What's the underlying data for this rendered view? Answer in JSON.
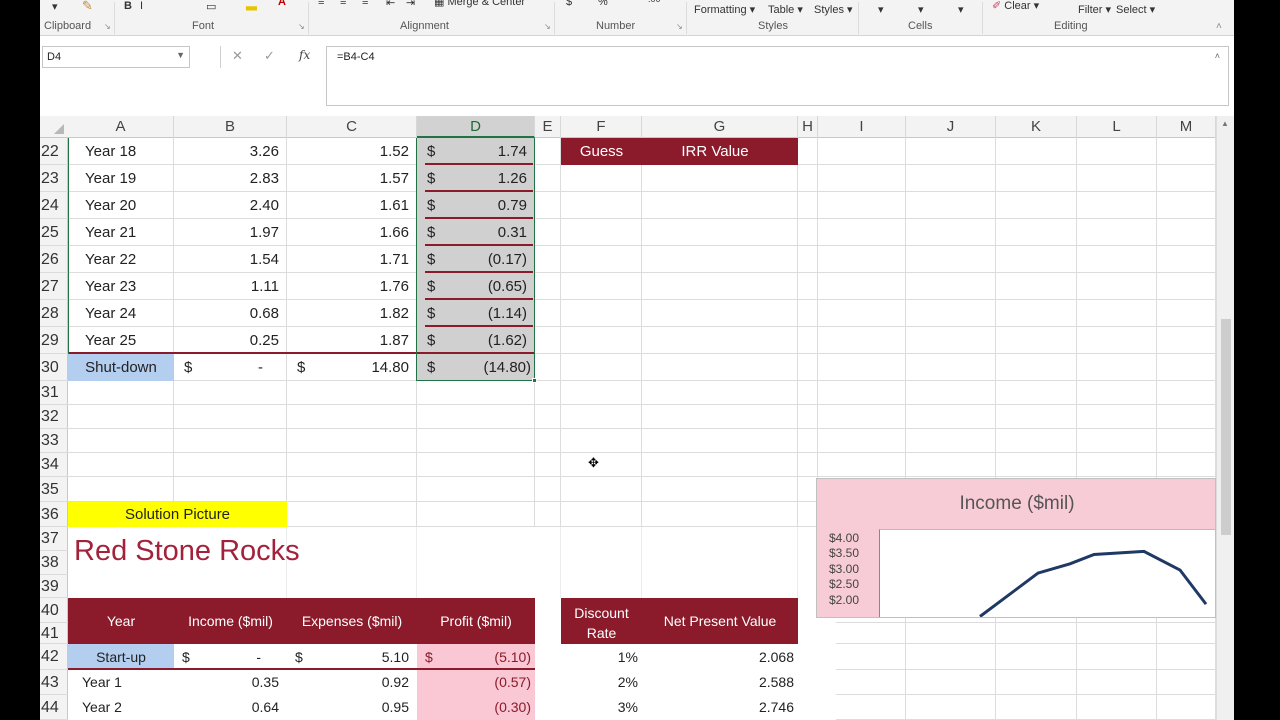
{
  "ribbon": {
    "groups": [
      "Clipboard",
      "Font",
      "Alignment",
      "Number",
      "Styles",
      "Cells",
      "Editing"
    ],
    "buttons": {
      "merge": "Merge & Center",
      "formatting": "Formatting",
      "table": "Table",
      "styles": "Styles",
      "clear": "Clear",
      "filter": "Filter",
      "select": "Select"
    }
  },
  "formula_bar": {
    "name_box": "D4",
    "formula": "=B4-C4",
    "fx": "fx"
  },
  "columns": [
    "A",
    "B",
    "C",
    "D",
    "E",
    "F",
    "G",
    "H",
    "I",
    "J",
    "K",
    "L",
    "M"
  ],
  "selected_column": "D",
  "row_numbers": [
    "22",
    "23",
    "24",
    "25",
    "26",
    "27",
    "28",
    "29",
    "30",
    "31",
    "32",
    "33",
    "34",
    "35",
    "36",
    "37",
    "38",
    "39",
    "40",
    "41",
    "42",
    "43",
    "44"
  ],
  "upper_table": {
    "rows": [
      {
        "year": "Year 18",
        "income": "3.26",
        "expenses": "1.52",
        "cur": "$",
        "profit": "1.74"
      },
      {
        "year": "Year 19",
        "income": "2.83",
        "expenses": "1.57",
        "cur": "$",
        "profit": "1.26"
      },
      {
        "year": "Year 20",
        "income": "2.40",
        "expenses": "1.61",
        "cur": "$",
        "profit": "0.79"
      },
      {
        "year": "Year 21",
        "income": "1.97",
        "expenses": "1.66",
        "cur": "$",
        "profit": "0.31"
      },
      {
        "year": "Year 22",
        "income": "1.54",
        "expenses": "1.71",
        "cur": "$",
        "profit": "(0.17)"
      },
      {
        "year": "Year 23",
        "income": "1.11",
        "expenses": "1.76",
        "cur": "$",
        "profit": "(0.65)"
      },
      {
        "year": "Year 24",
        "income": "0.68",
        "expenses": "1.82",
        "cur": "$",
        "profit": "(1.14)"
      },
      {
        "year": "Year 25",
        "income": "0.25",
        "expenses": "1.87",
        "cur": "$",
        "profit": "(1.62)"
      }
    ],
    "shutdown": {
      "label": "Shut-down",
      "cur_b": "$",
      "income": "-",
      "cur_c": "$",
      "expenses": "14.80",
      "cur_d": "$",
      "profit": "(14.80)"
    }
  },
  "irr_header": {
    "guess": "Guess",
    "irr": "IRR Value"
  },
  "solution_label": "Solution Picture",
  "picture": {
    "title": "Red Stone Rocks",
    "headers": {
      "year": "Year",
      "income": "Income ($mil)",
      "expenses": "Expenses ($mil)",
      "profit": "Profit ($mil)",
      "discount_line1": "Discount",
      "discount_line2": "Rate",
      "npv": "Net Present Value"
    },
    "rows": [
      {
        "year": "Start-up",
        "cur_b": "$",
        "income": "-",
        "cur_c": "$",
        "expenses": "5.10",
        "cur_d": "$",
        "profit": "(5.10)",
        "rate": "1%",
        "npv": "2.068"
      },
      {
        "year": "Year 1",
        "cur_b": "",
        "income": "0.35",
        "cur_c": "",
        "expenses": "0.92",
        "cur_d": "",
        "profit": "(0.57)",
        "rate": "2%",
        "npv": "2.588"
      },
      {
        "year": "Year 2",
        "cur_b": "",
        "income": "0.64",
        "cur_c": "",
        "expenses": "0.95",
        "cur_d": "",
        "profit": "(0.30)",
        "rate": "3%",
        "npv": "2.746"
      }
    ]
  },
  "chart_data": {
    "type": "line",
    "title": "Income ($mil)",
    "y_tick_labels": [
      "$4.00",
      "$3.50",
      "$3.00",
      "$2.50",
      "$2.00"
    ],
    "ylim": [
      2.0,
      4.0
    ],
    "series": [
      {
        "values": [
          1.5,
          2.9,
          3.2,
          3.5,
          3.6,
          3.0,
          1.9
        ]
      }
    ]
  },
  "colors": {
    "dark_red": "#8b1a2b",
    "light_blue": "#b4cef0",
    "yellow": "#ffff00",
    "pink": "#f9c8d4",
    "gray_sel": "#d0d0d0",
    "green_sel": "#217346",
    "line": "#1f3864"
  }
}
